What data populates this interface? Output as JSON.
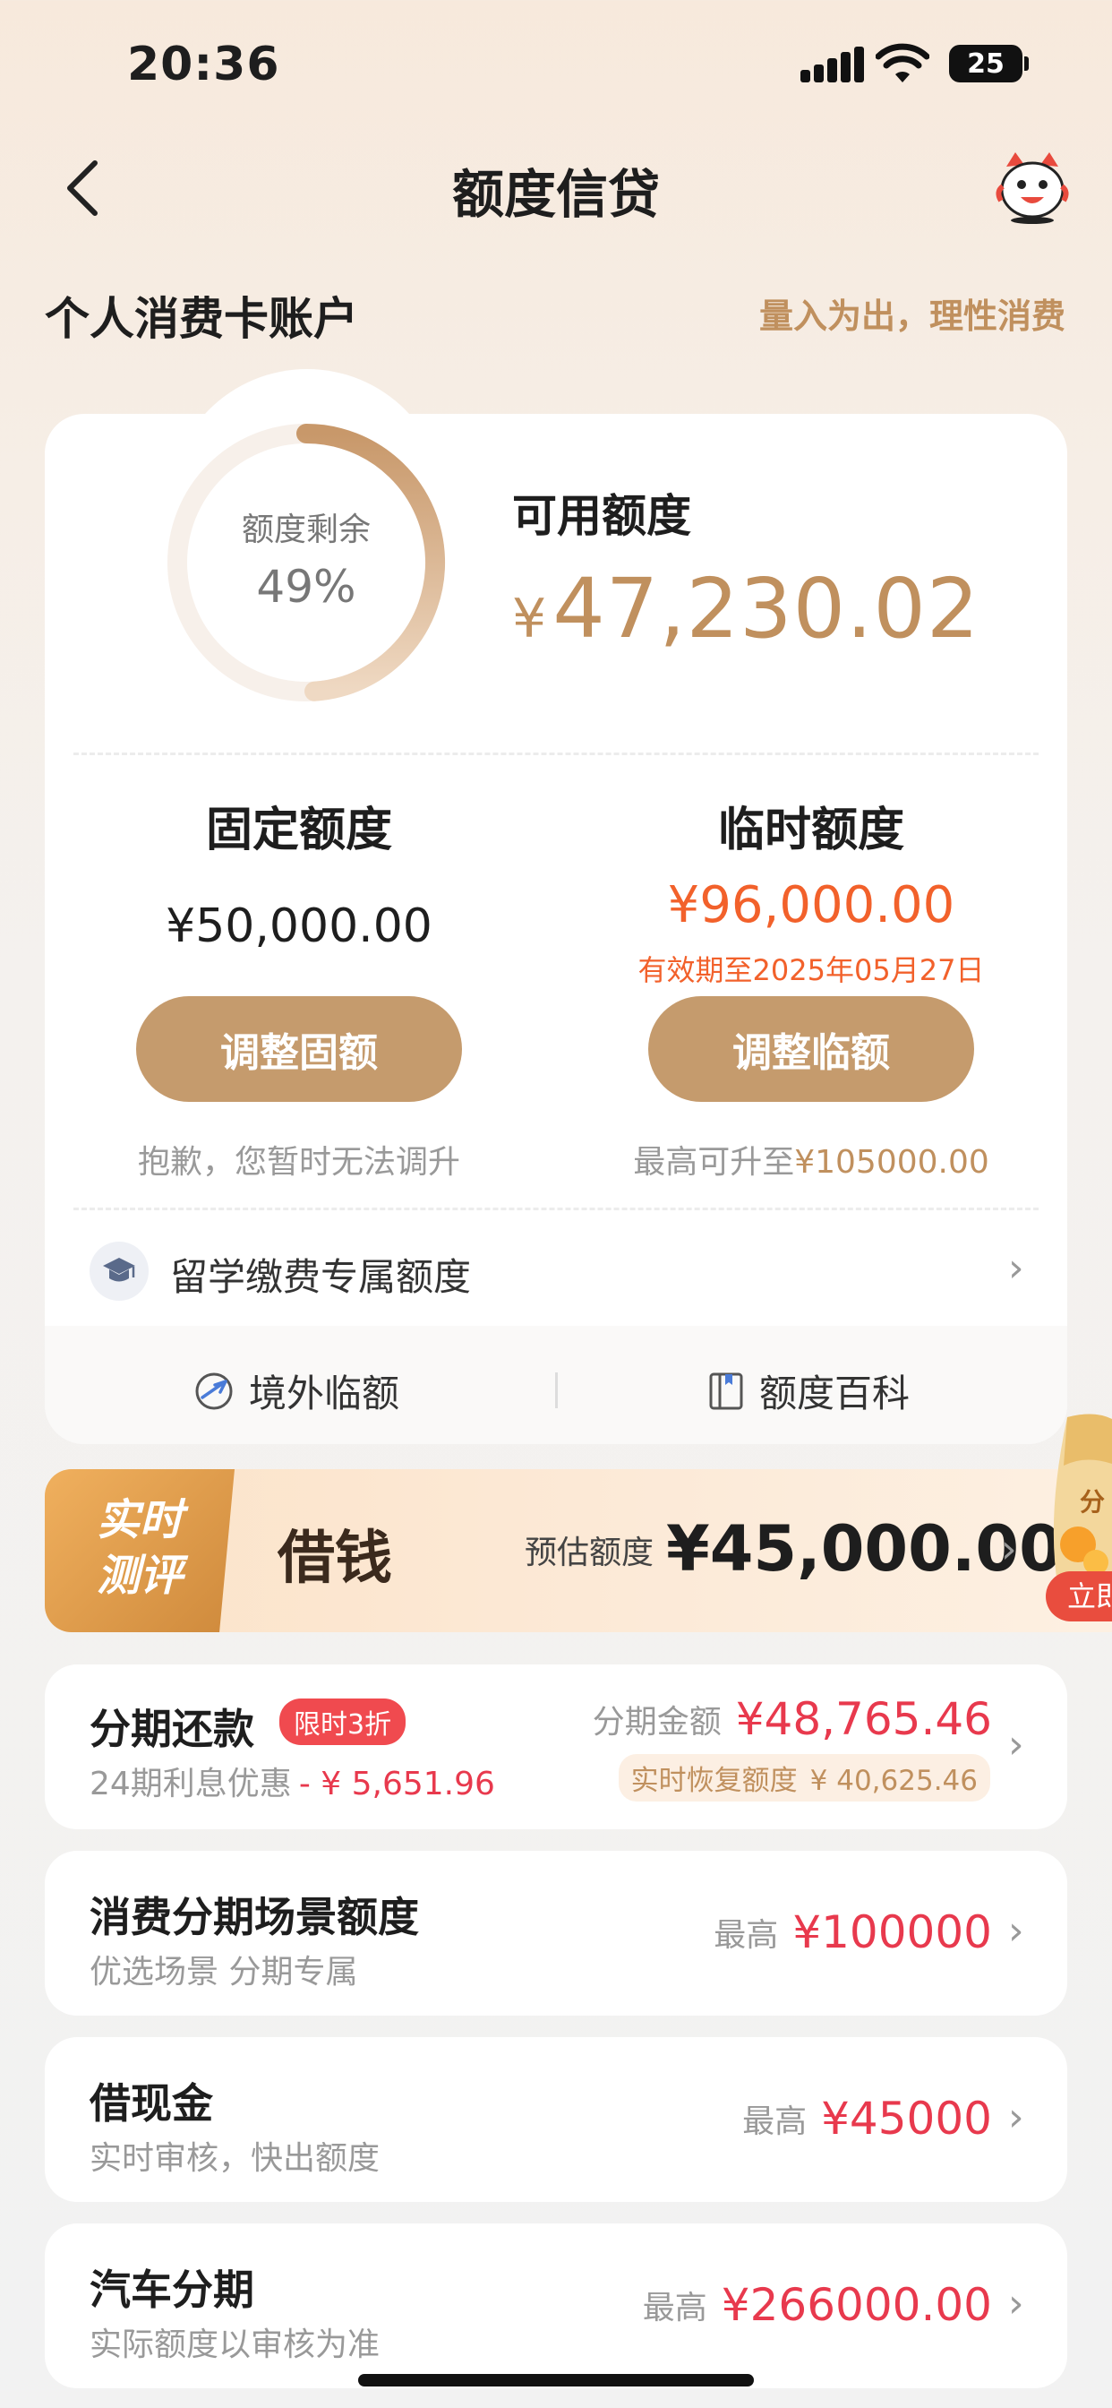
{
  "status_bar": {
    "time": "20:36",
    "battery": "25"
  },
  "nav": {
    "title": "额度信贷"
  },
  "account": {
    "title": "个人消费卡账户",
    "slogan": "量入为出，理性消费"
  },
  "credit": {
    "ring_label": "额度剩余",
    "ring_percent_text": "49%",
    "ring_fraction": 0.49,
    "available_label": "可用额度",
    "currency": "¥",
    "available_amount": "47,230.02",
    "fixed": {
      "heading": "固定额度",
      "amount": "¥50,000.00",
      "button": "调整固额",
      "note": "抱歉，您暂时无法调升"
    },
    "temporary": {
      "heading": "临时额度",
      "amount": "¥96,000.00",
      "valid_until": "有效期至2025年05月27日",
      "button": "调整临额",
      "note_prefix": "最高可升至",
      "note_value": "¥105000.00"
    },
    "study_abroad": "留学缴费专属额度",
    "links": {
      "overseas": "境外临额",
      "wiki": "额度百科"
    }
  },
  "banner": {
    "tag_line1": "实时",
    "tag_line2": "测评",
    "title": "借钱",
    "estimate_label": "预估额度",
    "estimate_amount": "¥45,000.00",
    "side_tag_top": "分",
    "side_tag_bottom": "立即"
  },
  "items": [
    {
      "title": "分期还款",
      "badge": "限时3折",
      "sub_prefix": "24期利息优惠",
      "sub_value": "- ¥ 5,651.96",
      "right_label": "分期金额",
      "right_amount": "¥48,765.46",
      "recover_label": "实时恢复额度",
      "recover_value": "¥ 40,625.46"
    },
    {
      "title": "消费分期场景额度",
      "sub": "优选场景 分期专属",
      "right_label": "最高",
      "right_amount": "¥100000"
    },
    {
      "title": "借现金",
      "sub": "实时审核，快出额度",
      "right_label": "最高",
      "right_amount": "¥45000"
    },
    {
      "title": "汽车分期",
      "sub": "实际额度以审核为准",
      "right_label": "最高",
      "right_amount": "¥266000.00"
    }
  ],
  "colors": {
    "accent_gold": "#c0905e",
    "button_gold": "#c59b6d",
    "orange": "#f2612b",
    "red": "#e8394d"
  },
  "icons": [
    "back-chevron-icon",
    "mascot-icon",
    "graduation-cap-icon",
    "airplane-icon",
    "book-icon",
    "chevron-right-icon"
  ]
}
